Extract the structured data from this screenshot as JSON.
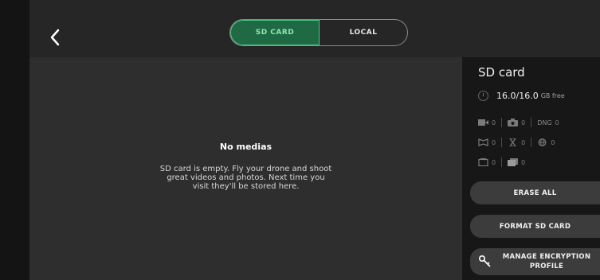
{
  "tabs": [
    {
      "label": "SD CARD",
      "active": true
    },
    {
      "label": "LOCAL",
      "active": false
    }
  ],
  "empty": {
    "title": "No medias",
    "message": "SD card is empty. Fly your drone and shoot great videos and photos. Next time you visit they'll be stored here."
  },
  "panel": {
    "title": "SD card",
    "storage_value": "16.0/16.0",
    "storage_unit": "GB free",
    "counts": {
      "video": "0",
      "photo": "0",
      "dng_label": "DNG",
      "dng": "0",
      "panorama": "0",
      "timelapse": "0",
      "sphere": "0",
      "gpslapse": "0",
      "burst": "0"
    },
    "buttons": {
      "erase": "ERASE ALL",
      "format": "FORMAT SD CARD",
      "encryption": "MANAGE ENCRYPTION PROFILE"
    }
  },
  "colors": {
    "accent": "#4fc987",
    "accent_bg": "#1f6a45"
  }
}
